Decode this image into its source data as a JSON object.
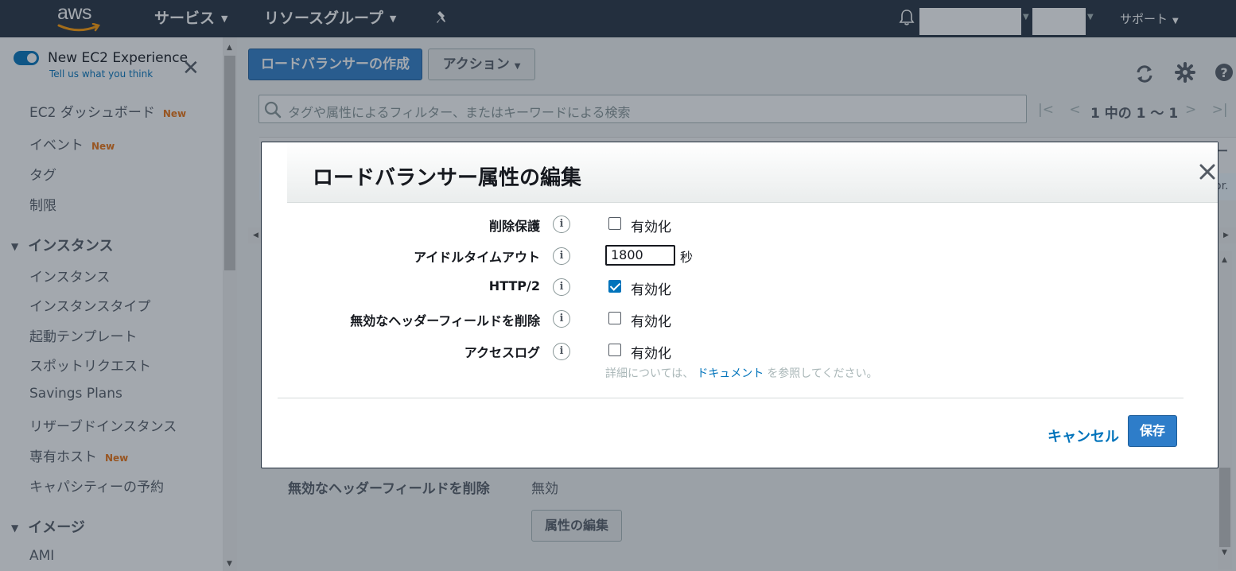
{
  "topnav": {
    "logo": "aws",
    "services": "サービス",
    "resource_groups": "リソースグループ",
    "support": "サポート"
  },
  "sidebar": {
    "experience_title": "New EC2 Experience",
    "experience_sub": "Tell us what you think",
    "items": [
      {
        "label": "EC2 ダッシュボード",
        "badge": "New"
      },
      {
        "label": "イベント",
        "badge": "New"
      },
      {
        "label": "タグ"
      },
      {
        "label": "制限"
      }
    ],
    "section_instances": "インスタンス",
    "instance_items": [
      {
        "label": "インスタンス"
      },
      {
        "label": "インスタンスタイプ"
      },
      {
        "label": "起動テンプレート"
      },
      {
        "label": "スポットリクエスト"
      },
      {
        "label": "Savings Plans"
      },
      {
        "label": "リザーブドインスタンス"
      },
      {
        "label": "専有ホスト",
        "badge": "New"
      },
      {
        "label": "キャパシティーの予約"
      }
    ],
    "section_images": "イメージ",
    "image_items": [
      {
        "label": "AMI"
      }
    ]
  },
  "toolbar": {
    "create_label": "ロードバランサーの作成",
    "actions_label": "アクション"
  },
  "search": {
    "placeholder": "タグや属性によるフィルター、またはキーワードによる検索"
  },
  "pager": {
    "text": "1 中の 1 ～ 1"
  },
  "table": {
    "header_fragment": "ー",
    "row_fragment": "or."
  },
  "behind": {
    "label": "無効なヘッダーフィールドを削除",
    "value": "無効",
    "edit_button": "属性の編集"
  },
  "modal": {
    "title": "ロードバランサー属性の編集",
    "fields": [
      {
        "label": "削除保護",
        "type": "checkbox",
        "checked": false,
        "option": "有効化"
      },
      {
        "label": "アイドルタイムアウト",
        "type": "number",
        "value": "1800",
        "unit": "秒"
      },
      {
        "label": "HTTP/2",
        "type": "checkbox",
        "checked": true,
        "option": "有効化"
      },
      {
        "label": "無効なヘッダーフィールドを削除",
        "type": "checkbox",
        "checked": false,
        "option": "有効化"
      },
      {
        "label": "アクセスログ",
        "type": "checkbox",
        "checked": false,
        "option": "有効化"
      }
    ],
    "info_glyph": "i",
    "doc_note_prefix": "詳細については、",
    "doc_link": "ドキュメント",
    "doc_note_suffix": "を参照してください。",
    "cancel_label": "キャンセル",
    "save_label": "保存"
  },
  "colors": {
    "nav_bg": "#232f3e",
    "primary": "#2e7dc9",
    "link": "#0073bb",
    "new_badge": "#ec7211"
  }
}
